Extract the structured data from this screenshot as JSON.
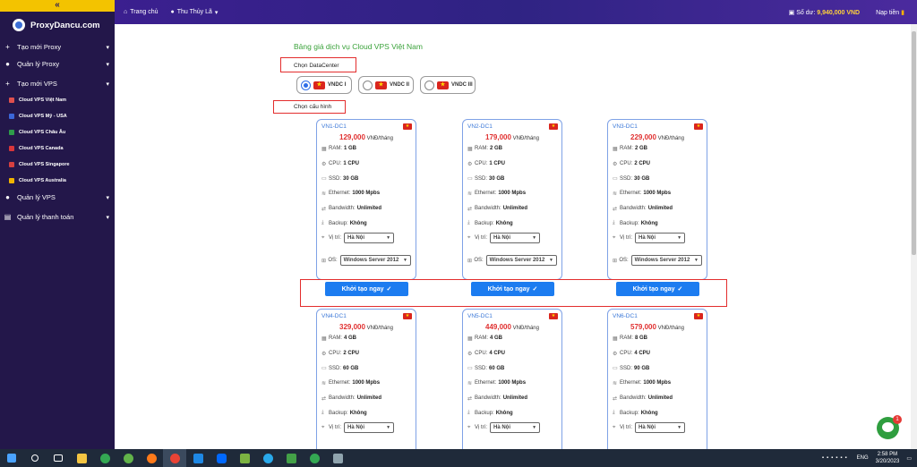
{
  "sidebar": {
    "collapse_icon": "«",
    "brand": "ProxyDancu.com",
    "items": [
      {
        "label": "Tạo mới Proxy",
        "icon": "plus-icon"
      },
      {
        "label": "Quản lý Proxy",
        "icon": "circle-icon"
      },
      {
        "label": "Tạo mới VPS",
        "icon": "plus-icon"
      }
    ],
    "sub_items": [
      {
        "label": "Cloud VPS Việt Nam",
        "color": "#e0504e"
      },
      {
        "label": "Cloud VPS Mỹ - USA",
        "color": "#3b66d8"
      },
      {
        "label": "Cloud VPS Châu Âu",
        "color": "#2e9c4a"
      },
      {
        "label": "Cloud VPS Canada",
        "color": "#d8363b"
      },
      {
        "label": "Cloud VPS Singapore",
        "color": "#d64040"
      },
      {
        "label": "Cloud VPS Australia",
        "color": "#f0b400"
      }
    ],
    "bottom_items": [
      {
        "label": "Quản lý VPS"
      },
      {
        "label": "Quản lý thanh toán"
      }
    ]
  },
  "topbar": {
    "home": "Trang chủ",
    "user": "Thu Thủy Lã",
    "balance_label": "Số dư:",
    "balance_value": "9,940,000 VND",
    "topup": "Nạp tiền"
  },
  "main": {
    "title": "Bảng giá dịch vụ Cloud VPS Việt Nam",
    "datacenter_label": "Chọn DataCenter",
    "config_label": "Chọn cấu hình",
    "datacenters": [
      {
        "label": "VNDC I",
        "selected": true
      },
      {
        "label": "VNDC II",
        "selected": false
      },
      {
        "label": "VNDC III",
        "selected": false
      }
    ],
    "labels": {
      "unit": "VNĐ/tháng",
      "ram": "RAM:",
      "cpu": "CPU:",
      "ssd": "SSD:",
      "ethernet": "Ethernet:",
      "bandwidth": "Bandwidth:",
      "backup": "Backup:",
      "location": "Vị trí:",
      "os": "OS:",
      "create": "Khởi tạo ngay"
    },
    "cards": [
      {
        "code": "VN1-DC1",
        "price": "129,000",
        "ram": "1 GB",
        "cpu": "1 CPU",
        "ssd": "30 GB",
        "ethernet": "1000 Mpbs",
        "bandwidth": "Unlimited",
        "backup": "Không",
        "location": "Hà Nội",
        "os": "Windows Server 2012"
      },
      {
        "code": "VN2-DC1",
        "price": "179,000",
        "ram": "2 GB",
        "cpu": "1 CPU",
        "ssd": "30 GB",
        "ethernet": "1000 Mpbs",
        "bandwidth": "Unlimited",
        "backup": "Không",
        "location": "Hà Nội",
        "os": "Windows Server 2012"
      },
      {
        "code": "VN3-DC1",
        "price": "229,000",
        "ram": "2 GB",
        "cpu": "2 CPU",
        "ssd": "30 GB",
        "ethernet": "1000 Mpbs",
        "bandwidth": "Unlimited",
        "backup": "Không",
        "location": "Hà Nội",
        "os": "Windows Server 2012"
      },
      {
        "code": "VN4-DC1",
        "price": "329,000",
        "ram": "4 GB",
        "cpu": "2 CPU",
        "ssd": "60 GB",
        "ethernet": "1000 Mpbs",
        "bandwidth": "Unlimited",
        "backup": "Không",
        "location": "Hà Nội"
      },
      {
        "code": "VN5-DC1",
        "price": "449,000",
        "ram": "4 GB",
        "cpu": "4 CPU",
        "ssd": "60 GB",
        "ethernet": "1000 Mpbs",
        "bandwidth": "Unlimited",
        "backup": "Không",
        "location": "Hà Nội"
      },
      {
        "code": "VN6-DC1",
        "price": "579,000",
        "ram": "8 GB",
        "cpu": "4 CPU",
        "ssd": "90 GB",
        "ethernet": "1000 Mpbs",
        "bandwidth": "Unlimited",
        "backup": "Không",
        "location": "Hà Nội"
      }
    ]
  },
  "chat_badge": "1",
  "taskbar": {
    "lang": "ENG",
    "time": "2:58 PM",
    "date": "3/20/2023"
  }
}
